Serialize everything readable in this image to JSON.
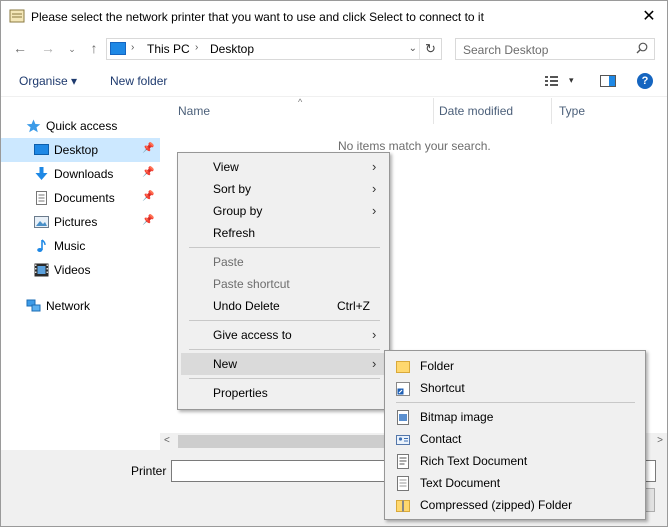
{
  "window": {
    "title": "Please select the network printer that you want to use and click Select to connect to it",
    "close_glyph": "✕"
  },
  "nav": {
    "back_glyph": "←",
    "forward_glyph": "→",
    "recent_glyph": "⌄",
    "up_glyph": "↑",
    "address": {
      "crumbs": [
        "This PC",
        "Desktop"
      ],
      "sep_glyph": "›",
      "dropdown_glyph": "⌄",
      "refresh_glyph": "↻"
    },
    "search": {
      "placeholder": "Search Desktop"
    }
  },
  "toolbar": {
    "organise_label": "Organise ▾",
    "new_folder_label": "New folder",
    "view_drop_glyph": "▾",
    "help_glyph": "?"
  },
  "sidebar": {
    "items": [
      {
        "label": "Quick access",
        "icon": "star-icon"
      },
      {
        "label": "Desktop",
        "icon": "desktop-icon",
        "pinned": true,
        "selected": true
      },
      {
        "label": "Downloads",
        "icon": "download-icon",
        "pinned": true
      },
      {
        "label": "Documents",
        "icon": "documents-icon",
        "pinned": true
      },
      {
        "label": "Pictures",
        "icon": "pictures-icon",
        "pinned": true
      },
      {
        "label": "Music",
        "icon": "music-icon"
      },
      {
        "label": "Videos",
        "icon": "videos-icon"
      },
      {
        "label": "Network",
        "icon": "network-icon"
      }
    ],
    "pin_glyph": "📌"
  },
  "list": {
    "columns": [
      "Name",
      "Date modified",
      "Type"
    ],
    "sort_glyph": "^",
    "empty_message": "No items match your search."
  },
  "scroll": {
    "left_glyph": "<",
    "right_glyph": ">"
  },
  "bottom": {
    "printer_label": "Printer"
  },
  "context_menu": {
    "view": "View",
    "sort_by": "Sort by",
    "group_by": "Group by",
    "refresh": "Refresh",
    "paste": "Paste",
    "paste_shortcut": "Paste shortcut",
    "undo_delete": "Undo Delete",
    "undo_shortcut": "Ctrl+Z",
    "give_access": "Give access to",
    "new": "New",
    "properties": "Properties",
    "submenu_glyph": "›"
  },
  "new_submenu": {
    "folder": "Folder",
    "shortcut": "Shortcut",
    "bitmap": "Bitmap image",
    "contact": "Contact",
    "rtf": "Rich Text Document",
    "text": "Text Document",
    "zip": "Compressed (zipped) Folder"
  },
  "colors": {
    "accent": "#0078d7",
    "selection": "#cce8ff",
    "menu_bg": "#f0f0f0",
    "folder": "#ffd86e"
  }
}
